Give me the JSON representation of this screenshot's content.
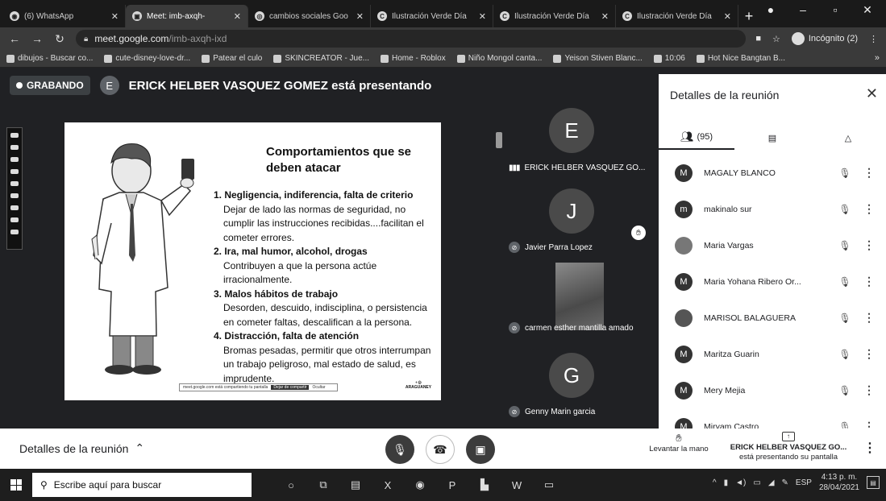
{
  "browser": {
    "tabs": [
      {
        "label": "(6) WhatsApp",
        "active": false
      },
      {
        "label": "Meet: imb-axqh-",
        "active": true
      },
      {
        "label": "cambios sociales Goo",
        "active": false
      },
      {
        "label": "Ilustración Verde Día",
        "active": false
      },
      {
        "label": "Ilustración Verde Día",
        "active": false
      },
      {
        "label": "Ilustración Verde Día",
        "active": false
      }
    ],
    "url_host": "meet.google.com",
    "url_path": "/imb-axqh-ixd",
    "incognito_label": "Incógnito (2)",
    "bookmarks": [
      "dibujos - Buscar co...",
      "cute-disney-love-dr...",
      "Patear el culo",
      "SKINCREATOR - Jue...",
      "Home - Roblox",
      "Niño Mongol canta...",
      "Yeison Stiven Blanc...",
      "10:06",
      "Hot Nice Bangtan B..."
    ]
  },
  "meet": {
    "recording_label": "GRABANDO",
    "presenter_initial": "E",
    "presenting_text": "ERICK HELBER VASQUEZ GOMEZ está presentando",
    "slide": {
      "title": "Comportamientos que se deben atacar",
      "items": [
        {
          "title": "1.  Negligencia, indiferencia, falta de criterio",
          "desc": "Dejar de lado las normas de seguridad, no cumplir las instrucciones recibidas....facilitan el cometer errores."
        },
        {
          "title": "2.  Ira, mal humor, alcohol, drogas",
          "desc": "Contribuyen a que la persona actúe irracionalmente."
        },
        {
          "title": "3.  Malos hábitos de trabajo",
          "desc": "Desorden, descuido, indisciplina, o persistencia en cometer faltas, descalifican a la persona."
        },
        {
          "title": "4.  Distracción, falta de atención",
          "desc": "Bromas pesadas, permitir que otros interrumpan un trabajo peligroso, mal estado de salud, es imprudente."
        }
      ],
      "share_notice": "meet.google.com está compartiendo tu pantalla",
      "stop_share": "Dejar de compartir",
      "hide": "Ocultar",
      "logo_text": "ARAGUANEY"
    },
    "tiles": [
      {
        "initial": "E",
        "name": "ERICK HELBER VASQUEZ GO...",
        "speaking": true
      },
      {
        "initial": "J",
        "name": "Javier Parra Lopez",
        "speaking": false,
        "hand_raised": true
      },
      {
        "initial": "",
        "name": "carmen esther mantilla amado",
        "speaking": false,
        "video": true
      },
      {
        "initial": "G",
        "name": "Genny Marin garcia",
        "speaking": false
      }
    ]
  },
  "panel": {
    "title": "Detalles de la reunión",
    "people_count": "(95)",
    "participants": [
      {
        "initial": "M",
        "name": "MAGALY BLANCO"
      },
      {
        "initial": "m",
        "name": "makinalo sur"
      },
      {
        "initial": "",
        "name": "Maria Vargas"
      },
      {
        "initial": "M",
        "name": "Maria Yohana Ribero Or..."
      },
      {
        "initial": "",
        "name": "MARISOL BALAGUERA"
      },
      {
        "initial": "M",
        "name": "Maritza Guarin"
      },
      {
        "initial": "M",
        "name": "Mery Mejia"
      },
      {
        "initial": "M",
        "name": "Miryam Castro"
      }
    ]
  },
  "bottom": {
    "details_label": "Detalles de la reunión",
    "raise_hand": "Levantar la mano",
    "presenter_name": "ERICK HELBER VASQUEZ GO...",
    "presenter_note": "está presentando su pantalla"
  },
  "taskbar": {
    "search_placeholder": "Escribe aquí para buscar",
    "lang": "ESP",
    "time": "4:13 p. m.",
    "date": "28/04/2021"
  }
}
